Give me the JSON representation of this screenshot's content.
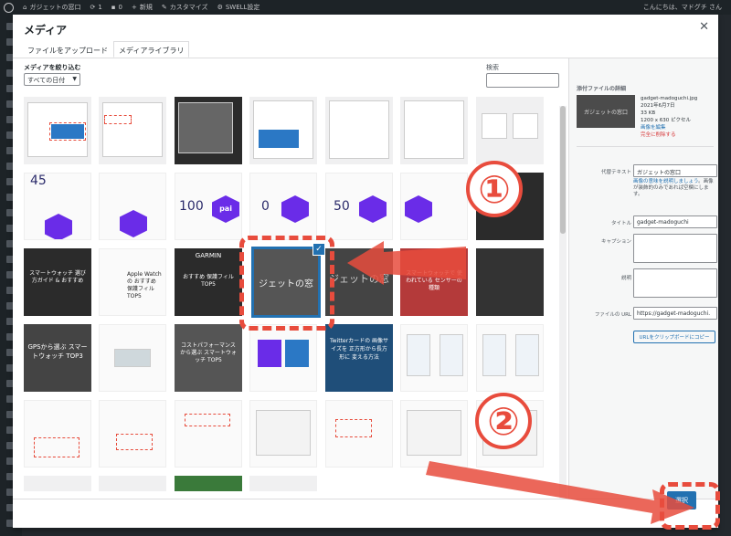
{
  "adminbar": {
    "site": "ガジェットの窓口",
    "updates": "1",
    "comments": "0",
    "new": "新規",
    "customize": "カスタマイズ",
    "swell": "SWELL設定",
    "greeting": "こんにちは、マドグチ さん"
  },
  "modal": {
    "title": "メディア",
    "close_icon": "close-icon",
    "tabs": [
      "ファイルをアップロード",
      "メディアライブラリ"
    ],
    "active_tab": 1,
    "filter_label": "メディアを絞り込む",
    "date_filter": "すべての日付",
    "search_label": "検索",
    "search_placeholder": ""
  },
  "grid": {
    "tiles": [
      [
        "",
        "",
        "",
        "",
        "",
        "",
        "",
        ""
      ],
      [
        "",
        "",
        "100",
        "0",
        "50",
        "pai",
        "",
        ""
      ],
      [
        "スマートウォッチ 選び方ガイド & おすすめ",
        "Apple Watch の おすすめ 保護フィル TOP5",
        "おすすめ 保護フィル TOP5",
        "ガジェットの窓口",
        "ジェットの窓",
        "スマートウォッチで 使われている センサーの種類",
        "",
        ""
      ],
      [
        "GPSから選ぶ スマートウォッチ TOP3",
        "",
        "コストパフォーマンス から選ぶ スマートウォッチ TOP5",
        "",
        "Twitterカードの 画像サイズを 正方形から長方形に 変える方法",
        "",
        "",
        ""
      ],
      [
        "",
        "",
        "",
        "",
        "",
        "",
        "",
        ""
      ]
    ],
    "garmin_label": "GARMIN",
    "pai_labels": [
      "45",
      "pai",
      "100",
      "0",
      "50"
    ],
    "selected_title": "ジェットの窓"
  },
  "sidebar": {
    "header": "添付ファイルの詳細",
    "thumb_text": "ガジェットの窓口",
    "filename": "gadget-madoguchi.jpg",
    "date": "2021年6月7日",
    "size": "33 KB",
    "dimensions": "1200 x 630 ピクセル",
    "edit_link": "画像を編集",
    "delete_link": "完全に削除する",
    "alt_label": "代替テキスト",
    "alt_value": "ガジェットの窓口",
    "alt_help_link": "画像の意味を説明しましょう",
    "alt_help_text": "。画像が装飾的のみであれば空欄にします。",
    "title_label": "タイトル",
    "title_value": "gadget-madoguchi",
    "caption_label": "キャプション",
    "desc_label": "説明",
    "url_label": "ファイルの URL",
    "url_value": "https://gadget-madoguchi.",
    "copy_button": "URLをクリップボードにコピー"
  },
  "footer": {
    "select_button": "選択"
  },
  "annotations": {
    "marker_1": "①",
    "marker_2": "②",
    "color": "#e84c3d"
  },
  "colors": {
    "accent": "#2271b1",
    "admin_bg": "#1d2327",
    "pai_purple": "#6a2ce8"
  }
}
